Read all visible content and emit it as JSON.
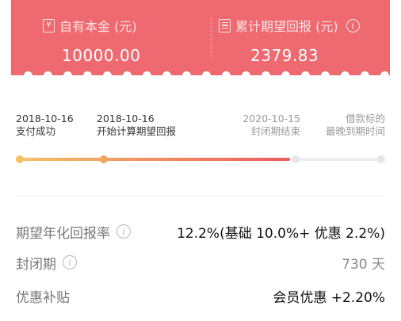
{
  "summary": {
    "principal": {
      "icon": "yen-icon",
      "icon_glyph": "¥",
      "label": "自有本金 (元)",
      "value": "10000.00"
    },
    "expected_return": {
      "icon": "document-icon",
      "label": "累计期望回报 (元)",
      "info_icon": "info-icon",
      "info_glyph": "i",
      "value": "2379.83"
    }
  },
  "timeline": {
    "milestones": [
      {
        "date": "2018-10-16",
        "desc": "支付成功"
      },
      {
        "date": "2018-10-16",
        "desc": "开始计算期望回报"
      },
      {
        "date": "2020-10-15",
        "desc": "封闭期结束"
      },
      {
        "date": "借款标的",
        "desc": "最晚到期时间"
      }
    ]
  },
  "details": {
    "rate": {
      "label": "期望年化回报率",
      "info_glyph": "i",
      "value": "12.2%(基础 10.0%+ 优惠 2.2%)"
    },
    "lock_period": {
      "label": "封闭期",
      "info_glyph": "i",
      "value": "730 天"
    },
    "subsidy": {
      "label": "优惠补贴",
      "value": "会员优惠 +2.20%"
    }
  },
  "colors": {
    "card_red": "#ee6a70",
    "progress_start": "#f3c268",
    "progress_end": "#ec5b5f",
    "progress_rest": "#ededed"
  }
}
